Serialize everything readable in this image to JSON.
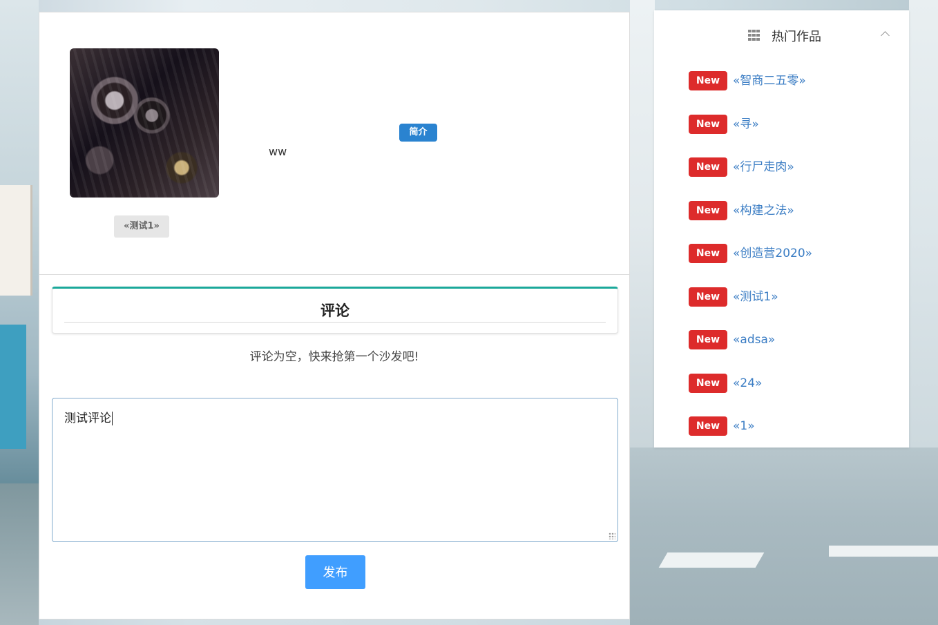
{
  "work": {
    "tag": "«测试1»",
    "intro_badge": "简介",
    "intro_text": "ww"
  },
  "comments": {
    "title": "评论",
    "empty_text": "评论为空，快来抢第一个沙发吧!",
    "input_value": "测试评论",
    "publish_label": "发布"
  },
  "hot": {
    "title": "热门作品",
    "badge_label": "New",
    "items": [
      {
        "title": "«智商二五零»"
      },
      {
        "title": "«寻»"
      },
      {
        "title": "«行尸走肉»"
      },
      {
        "title": "«构建之法»"
      },
      {
        "title": "«创造营2020»"
      },
      {
        "title": "«测试1»"
      },
      {
        "title": "«adsa»"
      },
      {
        "title": "«24»"
      },
      {
        "title": "«1»"
      }
    ]
  },
  "colors": {
    "accent_teal": "#1aa89a",
    "publish_blue": "#409eff",
    "badge_red": "#dd2b2b",
    "link_blue": "#3b7dc4",
    "intro_blue": "#2a83d0"
  },
  "icons": {
    "grid": "grid-icon",
    "collapse": "chevron-up-icon"
  }
}
